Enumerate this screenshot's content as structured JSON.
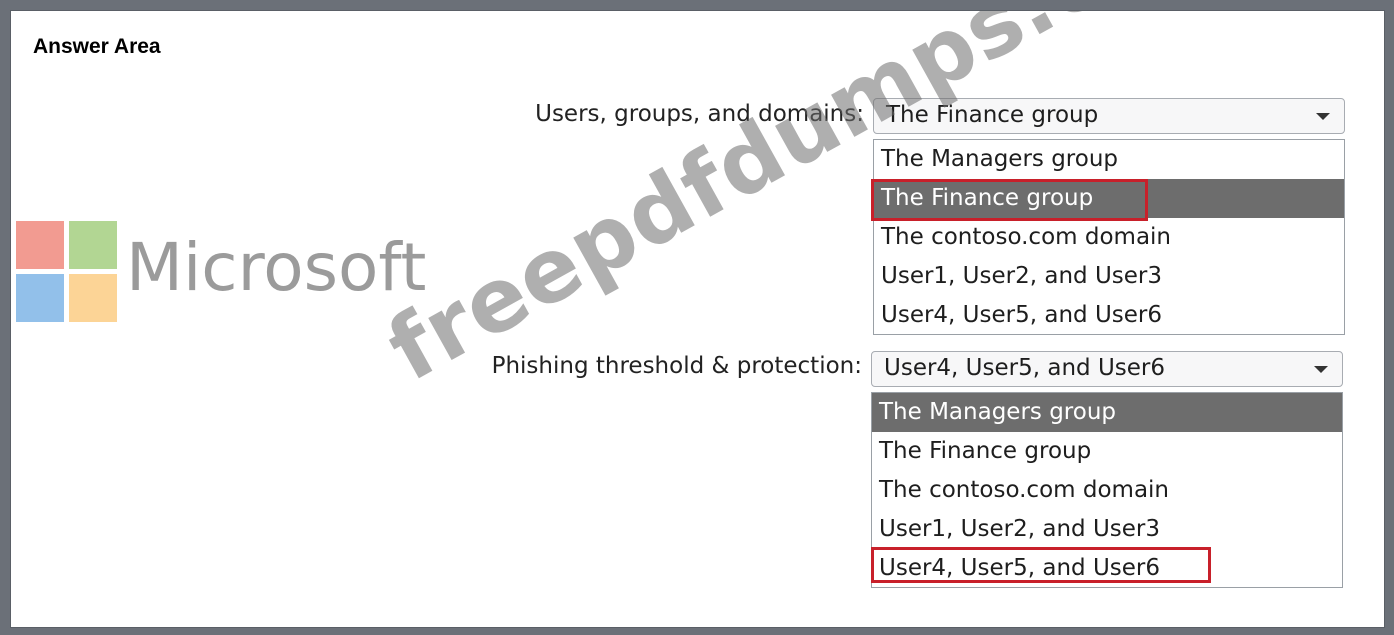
{
  "title": "Answer Area",
  "watermark": {
    "brand": "Microsoft",
    "site": "freepdfdumps.com",
    "logo_colors": [
      "#f08a7e",
      "#a4cf80",
      "#7fb5e6",
      "#fbcd84"
    ]
  },
  "fields": [
    {
      "label": "Users, groups, and domains:",
      "selected": "The Finance group",
      "options": [
        "The Managers group",
        "The Finance group",
        "The contoso.com domain",
        "User1, User2, and User3",
        "User4, User5, and User6"
      ],
      "highlighted_option": "The Finance group",
      "marked_answer": "The Finance group"
    },
    {
      "label": "Phishing threshold & protection:",
      "selected": "User4, User5, and User6",
      "options": [
        "The Managers group",
        "The Finance group",
        "The contoso.com domain",
        "User1, User2, and User3",
        "User4, User5, and User6"
      ],
      "highlighted_option": "The Managers group",
      "marked_answer": "User4, User5, and User6"
    }
  ],
  "colors": {
    "highlight": "#6d6d6d",
    "answer_box": "#c8202a"
  },
  "icons": [
    "dropdown-arrow-icon"
  ]
}
